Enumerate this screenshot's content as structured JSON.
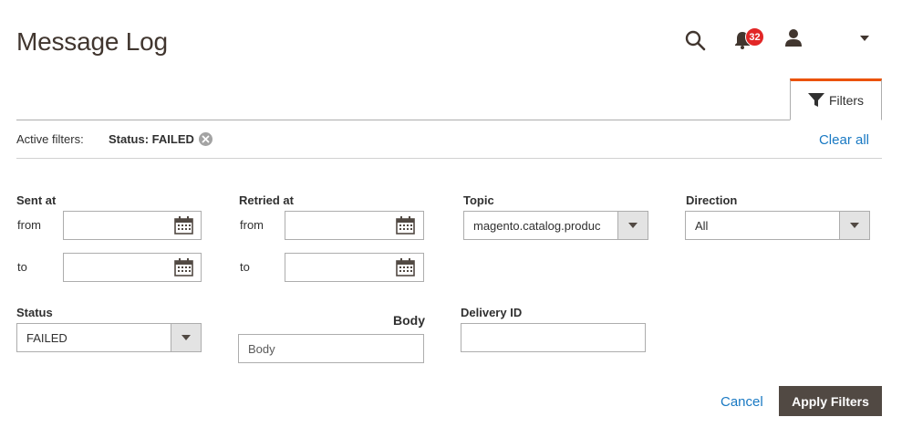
{
  "header": {
    "title": "Message Log",
    "notifications_count": "32",
    "icons": [
      "search-icon",
      "bell-icon",
      "user-icon",
      "caret-down-icon"
    ]
  },
  "tabs": {
    "filters_label": "Filters"
  },
  "active_filters": {
    "label": "Active filters:",
    "chips": [
      {
        "text": "Status: FAILED"
      }
    ],
    "clear_all": "Clear all"
  },
  "filters": {
    "sent_at": {
      "label": "Sent at",
      "from_label": "from",
      "to_label": "to",
      "from_value": "",
      "to_value": ""
    },
    "retried_at": {
      "label": "Retried at",
      "from_label": "from",
      "to_label": "to",
      "from_value": "",
      "to_value": ""
    },
    "topic": {
      "label": "Topic",
      "value": "magento.catalog.produc"
    },
    "direction": {
      "label": "Direction",
      "value": "All"
    },
    "status": {
      "label": "Status",
      "value": "FAILED"
    },
    "body": {
      "label": "Body",
      "placeholder": "Body",
      "value": ""
    },
    "delivery_id": {
      "label": "Delivery ID",
      "value": ""
    }
  },
  "actions": {
    "cancel": "Cancel",
    "apply": "Apply Filters"
  },
  "colors": {
    "accent_orange": "#eb5202",
    "link_blue": "#1979c3",
    "button_dark": "#514943",
    "badge_red": "#e22626"
  }
}
